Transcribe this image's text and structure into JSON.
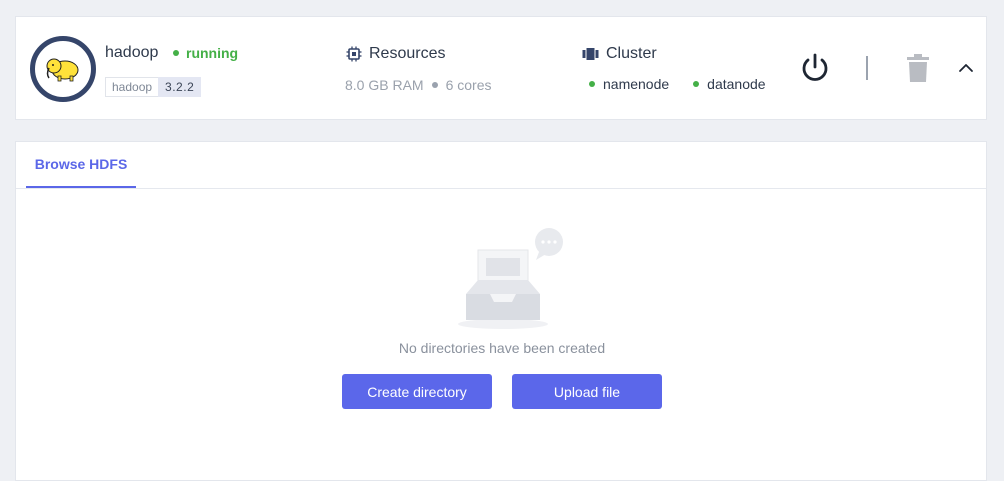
{
  "service": {
    "name": "hadoop",
    "status": "running",
    "tag_name": "hadoop",
    "tag_version": "3.2.2",
    "avatar_icon": "hadoop-elephant-logo"
  },
  "resources": {
    "title": "Resources",
    "ram": "8.0 GB RAM",
    "cores": "6 cores"
  },
  "cluster": {
    "title": "Cluster",
    "nodes": [
      "namenode",
      "datanode"
    ]
  },
  "actions": {
    "power_icon": "power-icon",
    "delete_icon": "trash-icon",
    "collapse_icon": "chevron-up-icon"
  },
  "tabs": [
    {
      "label": "Browse HDFS",
      "active": true
    }
  ],
  "empty_state": {
    "message": "No directories have been created",
    "create_label": "Create directory",
    "upload_label": "Upload file"
  },
  "colors": {
    "accent": "#5b67ea",
    "status_green": "#44b047",
    "avatar_ring": "#35456a"
  }
}
